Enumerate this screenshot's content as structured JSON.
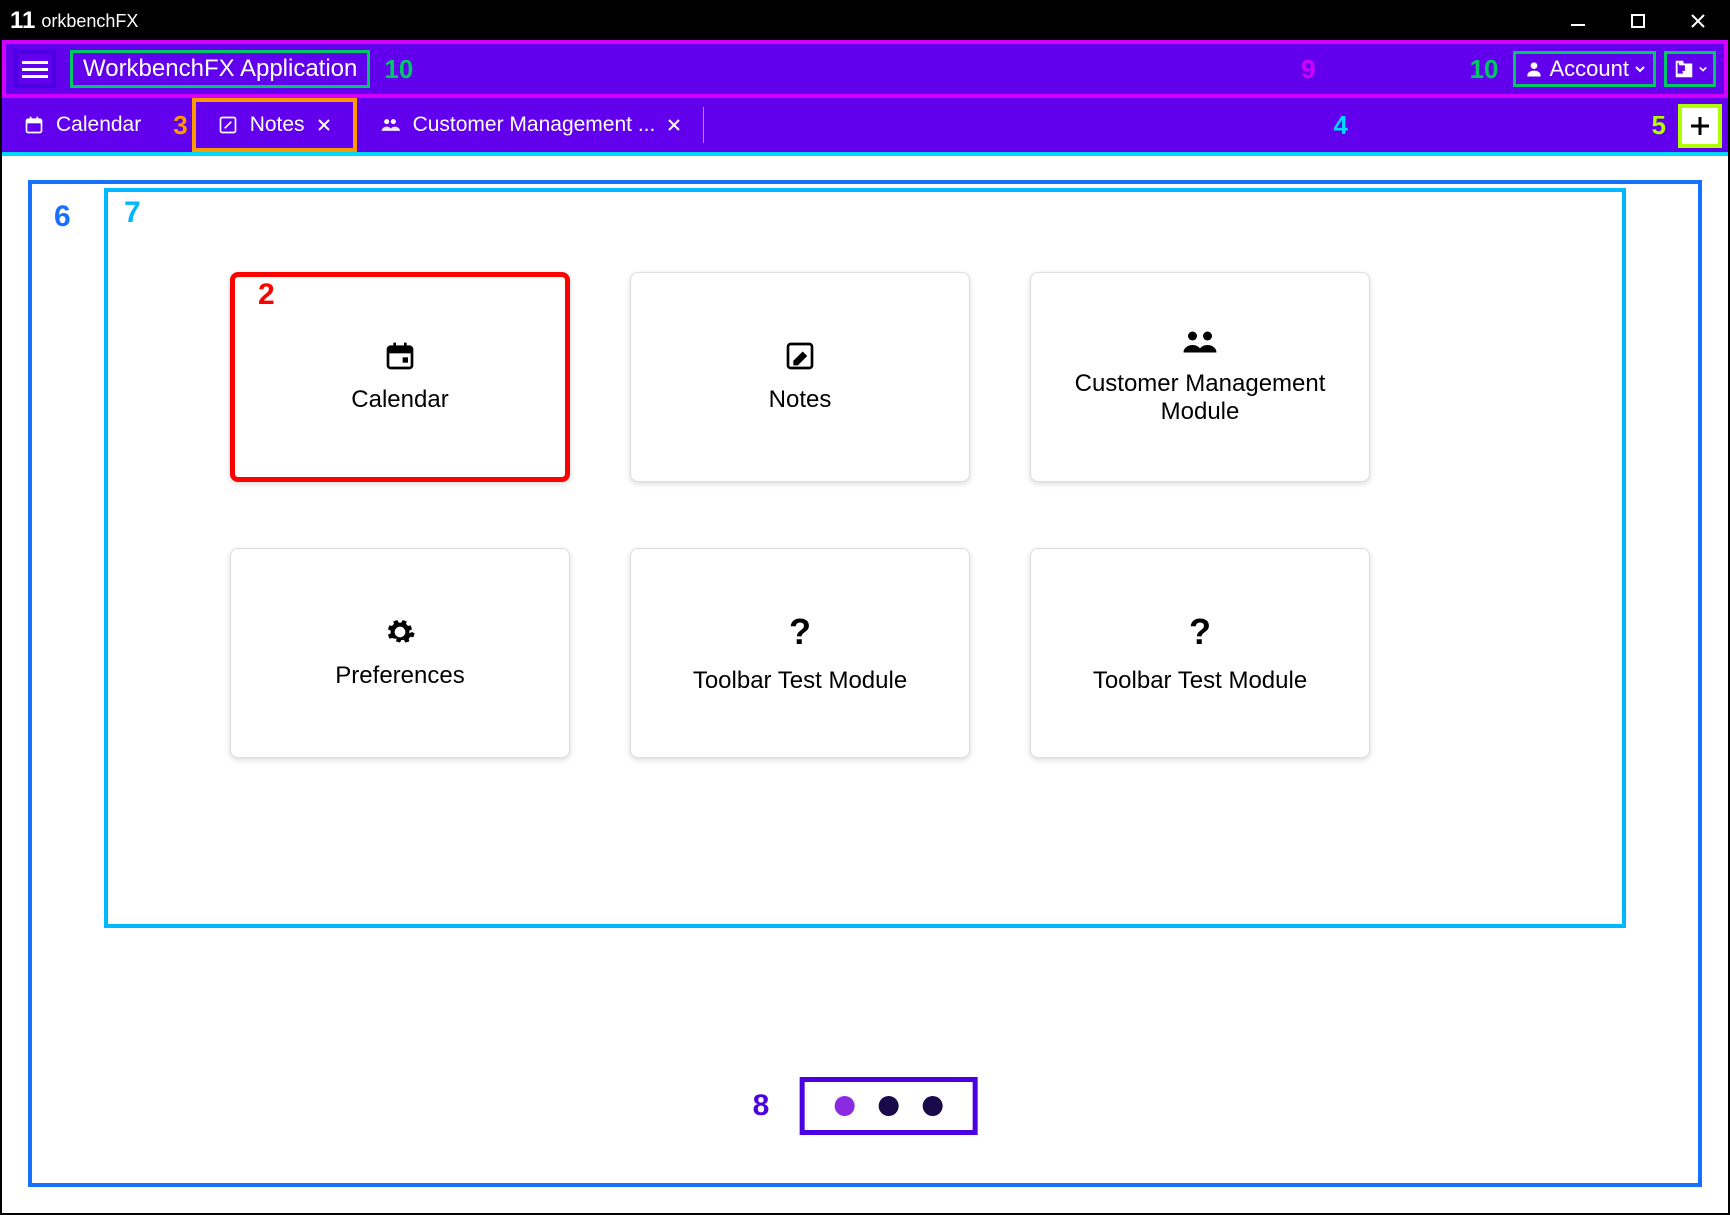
{
  "window": {
    "title_annot_num": "11",
    "title": "orkbenchFX"
  },
  "toolbar": {
    "app_title": "WorkbenchFX Application",
    "account_label": "Account",
    "annot_10a": "10",
    "annot_10b": "10",
    "annot_9": "9"
  },
  "tabs": {
    "items": [
      {
        "label": "Calendar",
        "closable": false
      },
      {
        "label": "Notes",
        "closable": true
      },
      {
        "label": "Customer Management ...",
        "closable": true
      }
    ],
    "annot_3": "3",
    "annot_4": "4",
    "annot_5": "5"
  },
  "content": {
    "annot_6": "6",
    "annot_7": "7",
    "annot_2": "2",
    "tiles": [
      {
        "label": "Calendar",
        "icon": "calendar"
      },
      {
        "label": "Notes",
        "icon": "edit"
      },
      {
        "label": "Customer Management Module",
        "icon": "people"
      },
      {
        "label": "Preferences",
        "icon": "gear"
      },
      {
        "label": "Toolbar Test Module",
        "icon": "help"
      },
      {
        "label": "Toolbar Test Module",
        "icon": "help"
      }
    ],
    "annot_8": "8"
  }
}
